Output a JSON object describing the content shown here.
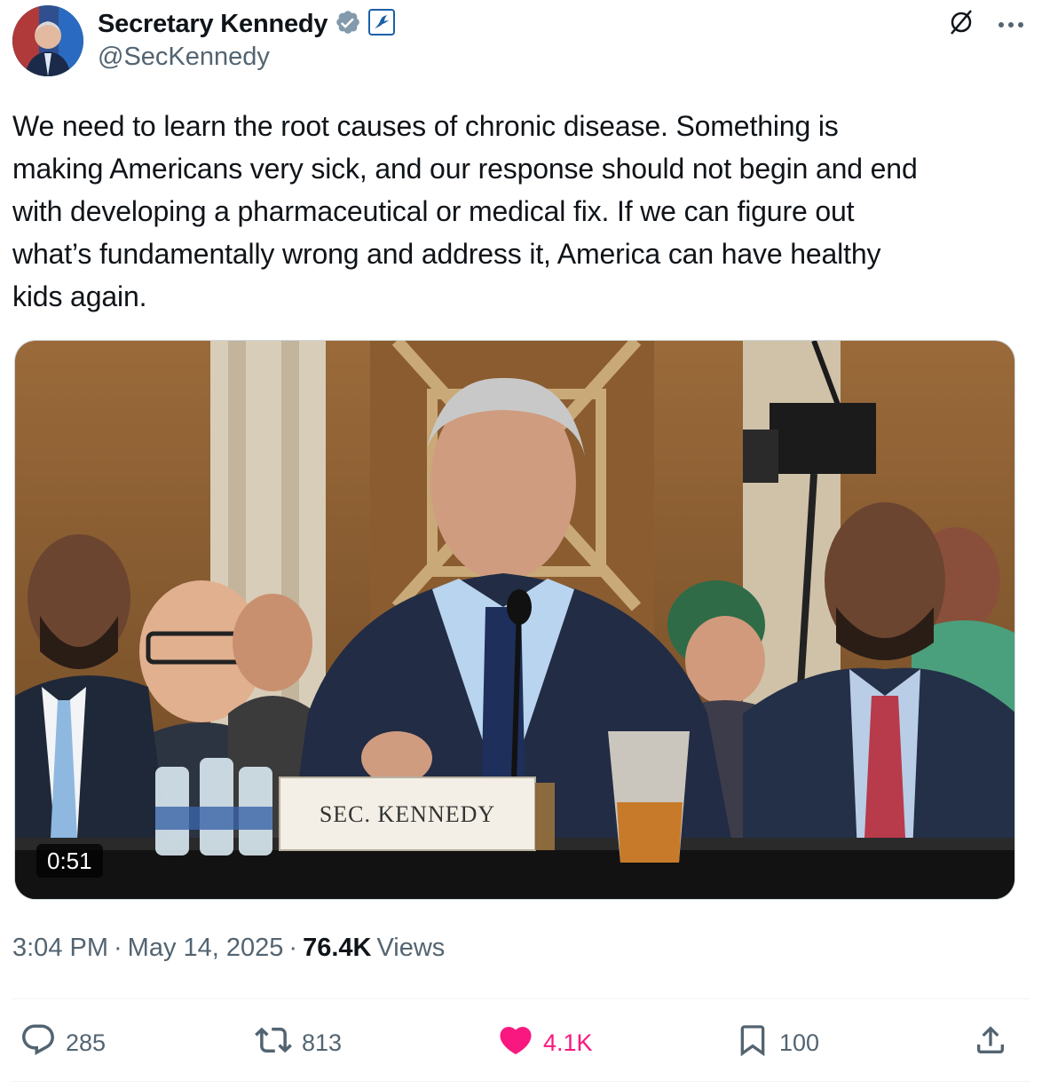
{
  "author": {
    "name": "Secretary Kennedy",
    "handle": "@SecKennedy",
    "verified_icon": "verified-badge-icon",
    "affiliation_icon": "hhs-eagle-badge-icon"
  },
  "tweet": {
    "text": "We need to learn the root causes of chronic disease. Something is\nmaking Americans very sick, and our response should not begin and end\nwith developing a pharmaceutical or medical fix. If we can figure out\nwhat’s fundamentally wrong and address it, America can have healthy\nkids again.",
    "video": {
      "duration": "0:51",
      "nameplate": "SEC. KENNEDY"
    },
    "time": "3:04 PM",
    "date": "May 14, 2025",
    "views_count": "76.4K",
    "views_label": "Views"
  },
  "actions": {
    "replies": "285",
    "reposts": "813",
    "likes": "4.1K",
    "bookmarks": "100"
  },
  "colors": {
    "accent": "#1d9bf0",
    "like": "#f91880",
    "muted": "#536471",
    "text": "#0f1419"
  }
}
